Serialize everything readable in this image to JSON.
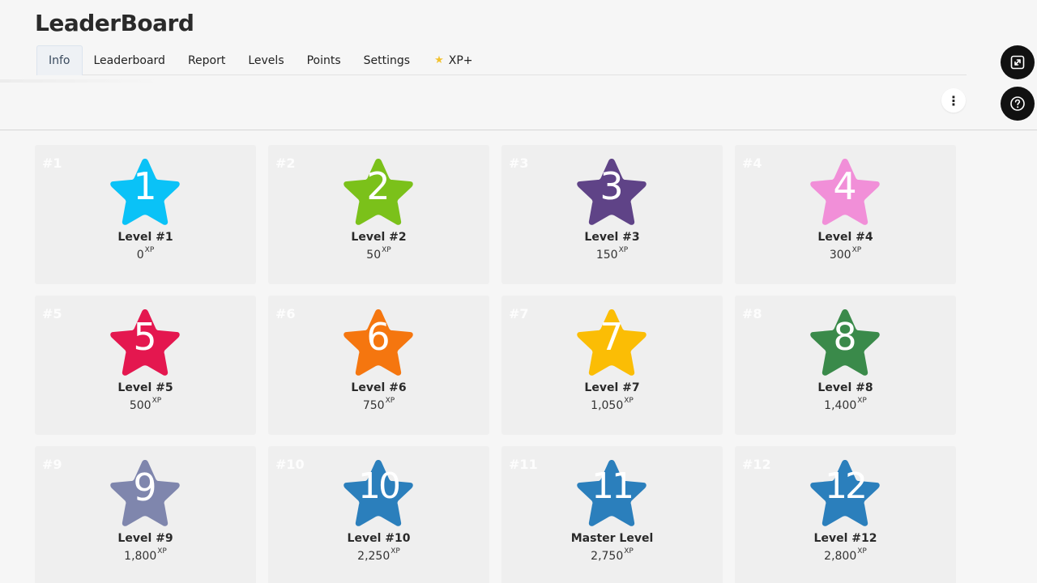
{
  "app": {
    "title": "LeaderBoard"
  },
  "tabs": [
    {
      "label": "Info",
      "active": true
    },
    {
      "label": "Leaderboard"
    },
    {
      "label": "Report"
    },
    {
      "label": "Levels"
    },
    {
      "label": "Points"
    },
    {
      "label": "Settings"
    },
    {
      "label": "XP+",
      "icon": "star-icon"
    }
  ],
  "toolbar": {
    "menu_icon": "⋮"
  },
  "fabs": {
    "expand_icon": "expand-icon",
    "help_icon": "question-icon"
  },
  "xp_unit": "XP",
  "levels": [
    {
      "rank": "#1",
      "number": "1",
      "name": "Level #1",
      "xp": "0",
      "color": "#0ac2f7"
    },
    {
      "rank": "#2",
      "number": "2",
      "name": "Level #2",
      "xp": "50",
      "color": "#7bc11a"
    },
    {
      "rank": "#3",
      "number": "3",
      "name": "Level #3",
      "xp": "150",
      "color": "#5f4387"
    },
    {
      "rank": "#4",
      "number": "4",
      "name": "Level #4",
      "xp": "300",
      "color": "#f18fd8"
    },
    {
      "rank": "#5",
      "number": "5",
      "name": "Level #5",
      "xp": "500",
      "color": "#e4174f"
    },
    {
      "rank": "#6",
      "number": "6",
      "name": "Level #6",
      "xp": "750",
      "color": "#f5760f"
    },
    {
      "rank": "#7",
      "number": "7",
      "name": "Level #7",
      "xp": "1,050",
      "color": "#fbbd05"
    },
    {
      "rank": "#8",
      "number": "8",
      "name": "Level #8",
      "xp": "1,400",
      "color": "#3a8a4a"
    },
    {
      "rank": "#9",
      "number": "9",
      "name": "Level #9",
      "xp": "1,800",
      "color": "#7f86ad"
    },
    {
      "rank": "#10",
      "number": "10",
      "name": "Level #10",
      "xp": "2,250",
      "color": "#2b7fbc"
    },
    {
      "rank": "#11",
      "number": "11",
      "name": "Master Level",
      "xp": "2,750",
      "color": "#2b7fbc"
    },
    {
      "rank": "#12",
      "number": "12",
      "name": "Level #12",
      "xp": "2,800",
      "color": "#2b7fbc"
    }
  ]
}
